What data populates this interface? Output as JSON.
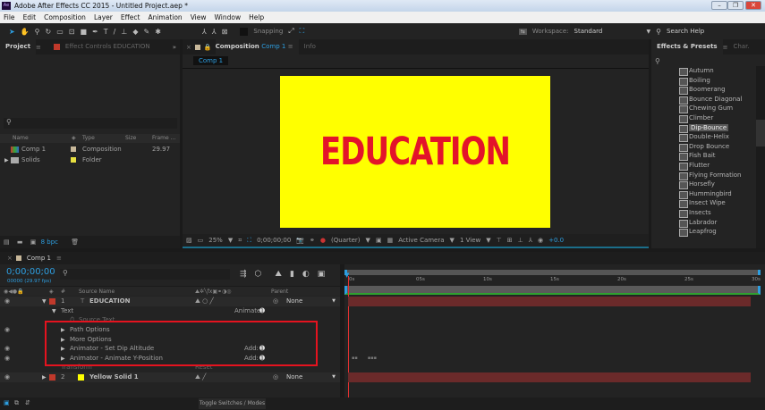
{
  "window": {
    "title": "Adobe After Effects CC 2015 - Untitled Project.aep *",
    "app_icon": "Ae"
  },
  "menu": [
    "File",
    "Edit",
    "Composition",
    "Layer",
    "Effect",
    "Animation",
    "View",
    "Window",
    "Help"
  ],
  "toolbar": {
    "snapping": "Snapping",
    "workspace_label": "Workspace:",
    "workspace_value": "Standard",
    "search_help": "Search Help"
  },
  "project": {
    "tab": "Project",
    "effect_controls_tab": "Effect Controls EDUCATION",
    "columns": [
      "Name",
      "Type",
      "Size",
      "Frame ..."
    ],
    "items": [
      {
        "name": "Comp 1",
        "type": "Composition",
        "frame": "29.97",
        "color": "#c8b89a"
      },
      {
        "name": "Solids",
        "type": "Folder",
        "frame": "",
        "color": "#e8e040"
      }
    ],
    "bpc": "8 bpc"
  },
  "composition": {
    "tab_label": "Composition",
    "tab_comp": "Comp 1",
    "info_tab": "Info",
    "breadcrumb": "Comp 1",
    "canvas_text": "EDUCATION",
    "canvas_bg": "#ffff00",
    "text_color": "#e3142a",
    "bottom": {
      "zoom": "25%",
      "timecode": "0;00;00;00",
      "resolution": "(Quarter)",
      "camera": "Active Camera",
      "views": "1 View",
      "exposure": "+0.0"
    }
  },
  "effects": {
    "tab": "Effects & Presets",
    "char_tab": "Char.",
    "items": [
      "Autumn",
      "Boiling",
      "Boomerang",
      "Bounce Diagonal",
      "Chewing Gum",
      "Climber",
      "Dip-Bounce",
      "Double-Helix",
      "Drop Bounce",
      "Fish Bait",
      "Flutter",
      "Flying Formation",
      "Horsefly",
      "Hummingbird",
      "Insect Wipe",
      "Insects",
      "Labrador",
      "Leapfrog"
    ],
    "selected": "Dip-Bounce"
  },
  "timeline": {
    "tab": "Comp 1",
    "timecode": "0;00;00;00",
    "fps": "00000 (29.97 fps)",
    "col_source": "Source Name",
    "col_parent": "Parent",
    "col_num": "#",
    "ruler": [
      "0s",
      "05s",
      "10s",
      "15s",
      "20s",
      "25s",
      "30s"
    ],
    "layers": [
      {
        "num": "1",
        "name": "EDUCATION",
        "parent": "None",
        "color": "#c0392b"
      },
      {
        "num": "2",
        "name": "Yellow Solid 1",
        "parent": "None",
        "color": "#c0392b"
      }
    ],
    "text_group": "Text",
    "animate": "Animate:",
    "source_text": "Source Text",
    "props": [
      "Path Options",
      "More Options",
      "Animator - Set Dip Altitude",
      "Animator - Animate Y-Position"
    ],
    "add": "Add:",
    "transform": "Transform",
    "reset": "Reset",
    "toggle": "Toggle Switches / Modes"
  }
}
